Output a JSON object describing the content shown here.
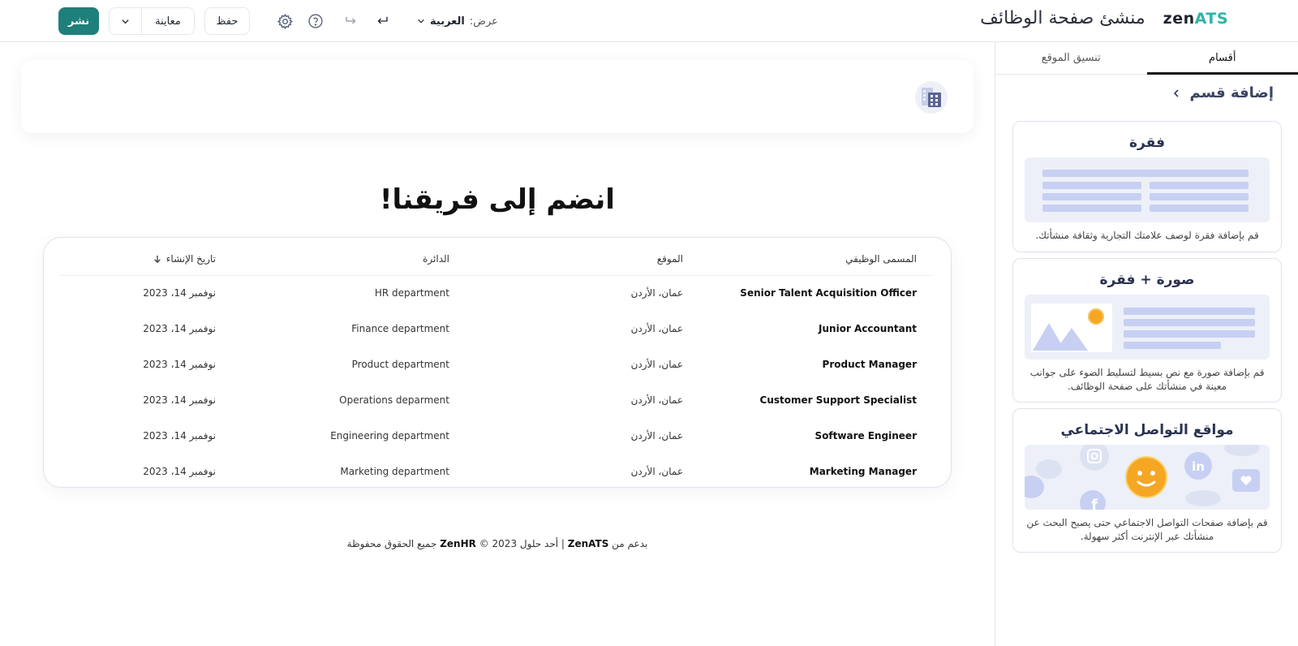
{
  "header": {
    "logo_zen": "zen",
    "logo_ats": "ATS",
    "title": "منشئ صفحة الوظائف",
    "view_label": "عرض:",
    "language": "العربية",
    "save_label": "حفظ",
    "preview_label": "معاينة",
    "publish_label": "نشر"
  },
  "main": {
    "heading": "انضم إلى فريقنا!",
    "columns": [
      "المسمى الوظيفي",
      "الموقع",
      "الدائرة",
      "تاريخ الإنشاء"
    ],
    "jobs": [
      {
        "title": "Senior Talent Acquisition Officer",
        "location": "عمان، الأردن",
        "department": "HR department",
        "date": "نوفمبر 14، 2023"
      },
      {
        "title": "Junior Accountant",
        "location": "عمان، الأردن",
        "department": "Finance department",
        "date": "نوفمبر 14، 2023"
      },
      {
        "title": "Product Manager",
        "location": "عمان، الأردن",
        "department": "Product department",
        "date": "نوفمبر 14، 2023"
      },
      {
        "title": "Customer Support Specialist",
        "location": "عمان، الأردن",
        "department": "Operations deparment",
        "date": "نوفمبر 14، 2023"
      },
      {
        "title": "Software Engineer",
        "location": "عمان، الأردن",
        "department": "Engineering department",
        "date": "نوفمبر 14، 2023"
      },
      {
        "title": "Marketing Manager",
        "location": "عمان، الأردن",
        "department": "Marketing department",
        "date": "نوفمبر 14، 2023"
      }
    ],
    "footer": {
      "prefix": "بدعم من",
      "brand": "ZenATS",
      "middle": "| أحد حلول",
      "company": "ZenHR",
      "suffix": "© 2023 جميع الحقوق محفوظة"
    }
  },
  "sidebar": {
    "tabs": [
      "أقسام",
      "تنسيق الموقع"
    ],
    "add_section": "إضافة قسم",
    "sections": [
      {
        "title": "فقرة",
        "description": "قم بإضافة فقرة لوصف علامتك التجارية وثقافة منشأتك."
      },
      {
        "title": "صورة + فقرة",
        "description": "قم بإضافة صورة مع نص بسيط لتسليط الضوء على جوانب معينة في منشأتك على صفحة الوظائف."
      },
      {
        "title": "مواقع التواصل الاجتماعي",
        "description": "قم بإضافة صفحات التواصل الاجتماعي حتى يصبح البحث عن منشأتك عبر الإنترنت أكثر سهولة."
      }
    ]
  },
  "colors": {
    "brand_teal": "#2fb4a8",
    "publish_button": "#1f7f7a",
    "accent_blue": "#c7d0f2"
  }
}
